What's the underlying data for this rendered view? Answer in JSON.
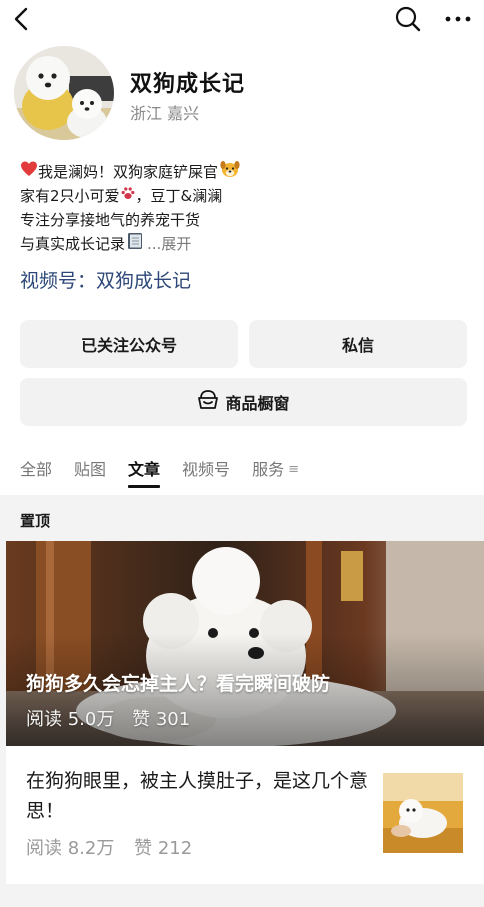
{
  "profile": {
    "name": "双狗成长记",
    "location": "浙江 嘉兴",
    "bio": {
      "line1": "我是澜妈！双狗家庭铲屎官",
      "line2_a": "家有2只小可爱",
      "line2_b": "，豆丁&澜澜",
      "line3": "专注分享接地气的养宠干货",
      "line4": "与真实成长记录",
      "expand": "...展开"
    },
    "channel": "视频号：双狗成长记"
  },
  "actions": {
    "follow": "已关注公众号",
    "message": "私信",
    "shop": "商品橱窗"
  },
  "tabs": {
    "all": "全部",
    "posts": "贴图",
    "articles": "文章",
    "channels": "视频号",
    "services": "服务",
    "more": "≡"
  },
  "pinned": {
    "label": "置顶",
    "hero_article": {
      "title": "狗狗多久会忘掉主人？看完瞬间破防",
      "reads": "阅读 5.0万",
      "likes": "赞 301"
    },
    "article": {
      "title": "在狗狗眼里，被主人摸肚子，是这几个意思！",
      "reads": "阅读 8.2万",
      "likes": "赞 212"
    }
  },
  "icons": {
    "back": "back-chevron-icon",
    "search": "search-icon",
    "more": "more-dots-icon",
    "shop": "shop-icon"
  },
  "colors": {
    "channel_link": "#2d4878",
    "button_bg": "#f2f2f2",
    "section_bg": "#f3f3f3"
  }
}
